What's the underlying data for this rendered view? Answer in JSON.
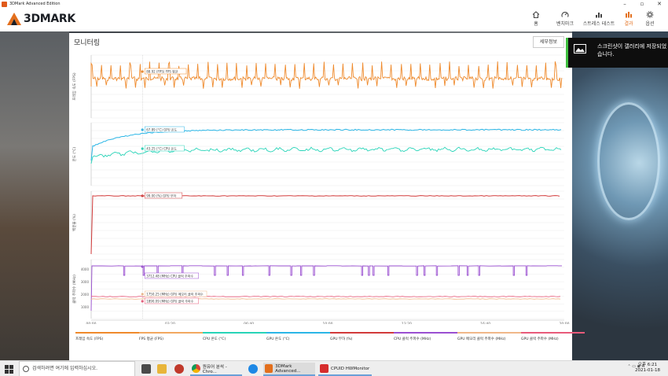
{
  "window": {
    "title": "3DMark Advanced Edition"
  },
  "brand": {
    "name": "3DMARK"
  },
  "nav": [
    {
      "label": "홈",
      "icon": "home-icon"
    },
    {
      "label": "벤치마크",
      "icon": "benchmark-icon"
    },
    {
      "label": "스트레스 테스트",
      "icon": "stress-test-icon"
    },
    {
      "label": "결과",
      "icon": "results-icon",
      "active": true
    },
    {
      "label": "옵션",
      "icon": "gear-icon"
    }
  ],
  "panel": {
    "title": "모니터링",
    "save_button": "세부정보"
  },
  "toast": {
    "message": "스크린샷이 갤러리에 저장되었습니다."
  },
  "chart_data": {
    "type": "line",
    "x_ticks": [
      "00:00",
      "03:20",
      "06:40",
      "10:00",
      "13:20",
      "16:40",
      "20:00"
    ],
    "panels": [
      {
        "ylabel": "프레임 속도 (FPS)",
        "yticks": [],
        "series": [
          {
            "name": "FPS 평균",
            "color": "#ef8a2c",
            "approx": 88.92
          }
        ],
        "annotations": [
          {
            "text": "88.92 (FPS) FPS 평균"
          }
        ]
      },
      {
        "ylabel": "온도 (°C)",
        "yticks": [],
        "series": [
          {
            "name": "GPU 온도",
            "color": "#2bb6e6",
            "approx": 67.89
          },
          {
            "name": "CPU 온도",
            "color": "#28d4b8",
            "approx": 43.25
          }
        ],
        "annotations": [
          {
            "text": "67.89 (°C) GPU 온도"
          },
          {
            "text": "43.25 (°C) CPU 온도"
          }
        ]
      },
      {
        "ylabel": "백분율 (%)",
        "yticks": [],
        "series": [
          {
            "name": "GPU 부하",
            "color": "#d23a3a",
            "approx": 99.0
          }
        ],
        "annotations": [
          {
            "text": "99.00 (%) GPU 부하"
          }
        ]
      },
      {
        "ylabel": "클럭 주파수 (MHz)",
        "yticks": [
          "4000",
          "3000",
          "2000",
          "1000"
        ],
        "series": [
          {
            "name": "CPU 클럭 주파수",
            "color": "#9a4fd1",
            "approx": 3712.48
          },
          {
            "name": "GPU 메모리 클럭 주파수",
            "color": "#f0b889",
            "approx": 1750.25
          },
          {
            "name": "GPU 클럭 주파수",
            "color": "#e85b7a",
            "approx": 1890.09
          }
        ],
        "annotations": [
          {
            "text": "3712.48 (MHz) CPU 클럭 주파수"
          },
          {
            "text": "1750.25 (MHz) GPU 메모리 클럭 주파수"
          },
          {
            "text": "1890.09 (MHz) GPU 클럭 주파수"
          }
        ]
      }
    ]
  },
  "legend": [
    {
      "label": "프레임 속도 (FPS)",
      "color": "#ef8a2c"
    },
    {
      "label": "FPS 평균 (FPS)",
      "color": "#f2a860"
    },
    {
      "label": "CPU 온도 (°C)",
      "color": "#28d4b8"
    },
    {
      "label": "GPU 온도 (°C)",
      "color": "#2bb6e6"
    },
    {
      "label": "GPU 부하 (%)",
      "color": "#d23a3a"
    },
    {
      "label": "CPU 클럭 주파수 (MHz)",
      "color": "#9a4fd1"
    },
    {
      "label": "GPU 메모리 클럭 주파수 (MHz)",
      "color": "#f0b889"
    },
    {
      "label": "GPU 클럭 주파수 (MHz)",
      "color": "#e85b7a"
    }
  ],
  "taskbar": {
    "search_placeholder": "검색하려면 여기에 입력하십시오.",
    "apps": [
      {
        "label": "원유어 분석 - Chro...",
        "icon": "chrome-icon"
      },
      {
        "label": "3DMark Advanced...",
        "icon": "3dmark-icon"
      },
      {
        "label": "CPUID HWMonitor",
        "icon": "hwmonitor-icon"
      }
    ],
    "tray_lang": "A",
    "time": "오후 6:21",
    "date": "2021-01-18"
  }
}
